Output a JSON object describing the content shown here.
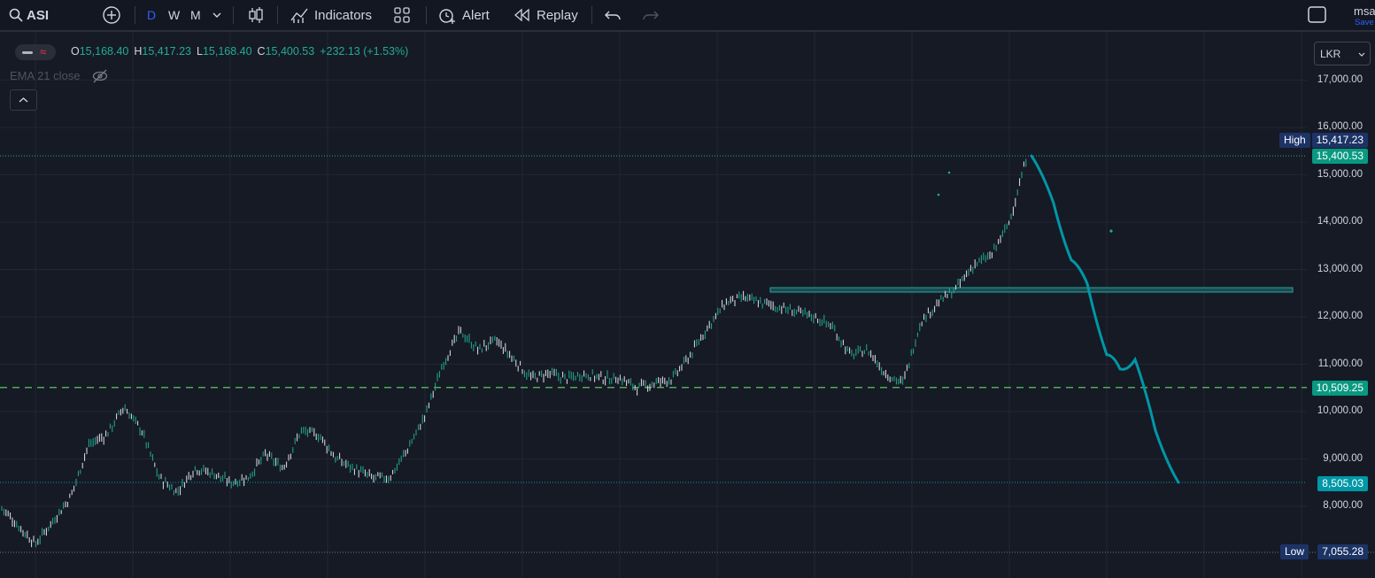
{
  "toolbar": {
    "symbol": "ASI",
    "intervals": [
      "D",
      "W",
      "M"
    ],
    "indicators_label": "Indicators",
    "alert_label": "Alert",
    "replay_label": "Replay",
    "user_name": "msa",
    "save_label": "Save"
  },
  "legend": {
    "open_key": "O",
    "open_value": "15,168.40",
    "high_key": "H",
    "high_value": "15,417.23",
    "low_key": "L",
    "low_value": "15,168.40",
    "close_key": "C",
    "close_value": "15,400.53",
    "change": "+232.13 (+1.53%)",
    "indicator": "EMA 21 close"
  },
  "currency": "LKR",
  "colors": {
    "background": "#161a25",
    "accent_teal": "#0097a7",
    "up_green": "#22ab94",
    "dashed_green": "#4caf50",
    "tag_blue": "#1c3366"
  },
  "price_axis": {
    "ticks": [
      "17,000.00",
      "16,000.00",
      "15,000.00",
      "14,000.00",
      "13,000.00",
      "12,000.00",
      "11,000.00",
      "10,000.00",
      "9,000.00",
      "8,000.00"
    ]
  },
  "tags": {
    "high_label": "High",
    "high_value": "15,417.23",
    "last_value": "15,400.53",
    "level_value": "10,509.25",
    "target_value": "8,505.03",
    "low_label": "Low",
    "low_value": "7,055.28"
  },
  "chart_data": {
    "type": "line",
    "series": [
      {
        "x": [
          0,
          20,
          40,
          60,
          80,
          100,
          120,
          140,
          160,
          180,
          200,
          220,
          240,
          260,
          280,
          300,
          320,
          340,
          360,
          380,
          400,
          420,
          440,
          460,
          480,
          500,
          520,
          540,
          560,
          580,
          600,
          620,
          640,
          660,
          680,
          700,
          720,
          740,
          760,
          780,
          800,
          820,
          840,
          860,
          880,
          900,
          920,
          940,
          960,
          980,
          1000,
          1020,
          1040,
          1060,
          1080,
          1100,
          1120,
          1140,
          1160
        ],
        "values": [
          8000,
          7600,
          7200,
          7700,
          8200,
          9300,
          9500,
          10100,
          9600,
          8600,
          8300,
          8800,
          8700,
          8500,
          8600,
          9100,
          8800,
          9600,
          9500,
          9000,
          8800,
          8600,
          8600,
          9200,
          9900,
          11000,
          11700,
          11300,
          11500,
          11100,
          10700,
          10800,
          10700,
          10800,
          10700,
          10700,
          10500,
          10600,
          10700,
          11200,
          11800,
          12300,
          12400,
          12300,
          12200,
          12100,
          12000,
          11800,
          11200,
          11300,
          10800,
          10600,
          11900,
          12300,
          12600,
          13100,
          13300,
          14000,
          15400
        ]
      }
    ],
    "projection": [
      15400,
      14400,
      13200,
      12700,
      11200,
      10900,
      11100,
      9600,
      8505.03
    ],
    "levels": [
      15400.53,
      10509.25,
      8505.03,
      7055.28,
      15417.23
    ],
    "ylim": [
      6900,
      17400
    ]
  }
}
